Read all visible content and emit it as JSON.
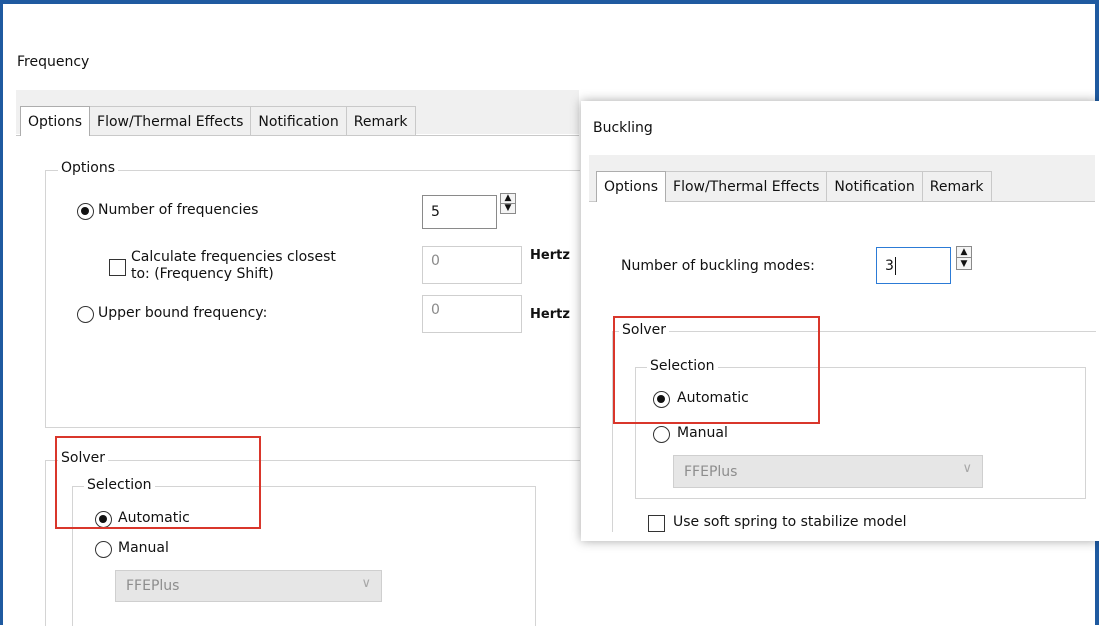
{
  "frequency": {
    "title": "Frequency",
    "tabs": [
      "Options",
      "Flow/Thermal Effects",
      "Notification",
      "Remark"
    ],
    "options_group": "Options",
    "number_of_frequencies_label": "Number of frequencies",
    "number_of_frequencies_value": "5",
    "calc_closest_line1": "Calculate frequencies closest",
    "calc_closest_line2": "to: (Frequency Shift)",
    "calc_closest_value": "0",
    "upper_bound_label": "Upper bound frequency:",
    "upper_bound_value": "0",
    "unit": "Hertz",
    "solver_group": "Solver",
    "selection_group": "Selection",
    "automatic": "Automatic",
    "manual": "Manual",
    "solver_select": "FFEPlus"
  },
  "buckling": {
    "title": "Buckling",
    "tabs": [
      "Options",
      "Flow/Thermal Effects",
      "Notification",
      "Remark"
    ],
    "modes_label": "Number of buckling modes:",
    "modes_value": "3",
    "solver_group": "Solver",
    "selection_group": "Selection",
    "automatic": "Automatic",
    "manual": "Manual",
    "solver_select": "FFEPlus",
    "soft_spring": "Use soft spring to stabilize model"
  },
  "colors": {
    "accent_border": "#1f5aa0",
    "highlight_box": "#d9362b",
    "focus_border": "#2c7bd6"
  }
}
